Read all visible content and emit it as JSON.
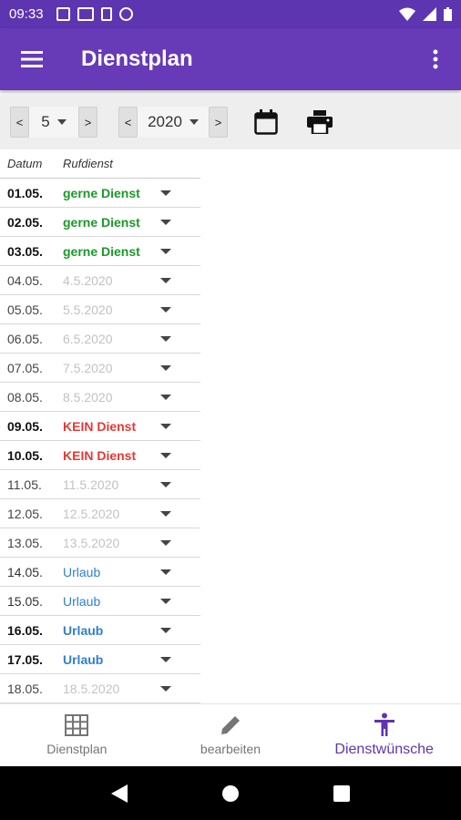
{
  "status": {
    "time": "09:33"
  },
  "appbar": {
    "title": "Dienstplan"
  },
  "toolbar": {
    "month": "5",
    "year": "2020",
    "prev": "<",
    "next": ">"
  },
  "table": {
    "headers": {
      "date": "Datum",
      "duty": "Rufdienst"
    },
    "rows": [
      {
        "date": "01.05.",
        "value": "gerne Dienst",
        "kind": "wish"
      },
      {
        "date": "02.05.",
        "value": "gerne Dienst",
        "kind": "wish"
      },
      {
        "date": "03.05.",
        "value": "gerne Dienst",
        "kind": "wish"
      },
      {
        "date": "04.05.",
        "value": "4.5.2020",
        "kind": "empty"
      },
      {
        "date": "05.05.",
        "value": "5.5.2020",
        "kind": "empty"
      },
      {
        "date": "06.05.",
        "value": "6.5.2020",
        "kind": "empty"
      },
      {
        "date": "07.05.",
        "value": "7.5.2020",
        "kind": "empty"
      },
      {
        "date": "08.05.",
        "value": "8.5.2020",
        "kind": "empty"
      },
      {
        "date": "09.05.",
        "value": "KEIN Dienst",
        "kind": "no"
      },
      {
        "date": "10.05.",
        "value": "KEIN Dienst",
        "kind": "no"
      },
      {
        "date": "11.05.",
        "value": "11.5.2020",
        "kind": "empty"
      },
      {
        "date": "12.05.",
        "value": "12.5.2020",
        "kind": "empty"
      },
      {
        "date": "13.05.",
        "value": "13.5.2020",
        "kind": "empty"
      },
      {
        "date": "14.05.",
        "value": "Urlaub",
        "kind": "vacation"
      },
      {
        "date": "15.05.",
        "value": "Urlaub",
        "kind": "vacation"
      },
      {
        "date": "16.05.",
        "value": "Urlaub",
        "kind": "vacation-bold"
      },
      {
        "date": "17.05.",
        "value": "Urlaub",
        "kind": "vacation-bold"
      },
      {
        "date": "18.05.",
        "value": "18.5.2020",
        "kind": "empty"
      }
    ]
  },
  "bottom_nav": {
    "items": [
      {
        "label": "Dienstplan",
        "icon": "grid-icon"
      },
      {
        "label": "bearbeiten",
        "icon": "pencil-icon"
      },
      {
        "label": "Dienstwünsche",
        "icon": "person-icon"
      }
    ]
  },
  "colors": {
    "primary": "#673ab7",
    "status": "#5e35b1",
    "wish": "#1a9a2a",
    "no": "#e53935",
    "vacation": "#2f7fd0",
    "muted": "#c2c2c2"
  }
}
